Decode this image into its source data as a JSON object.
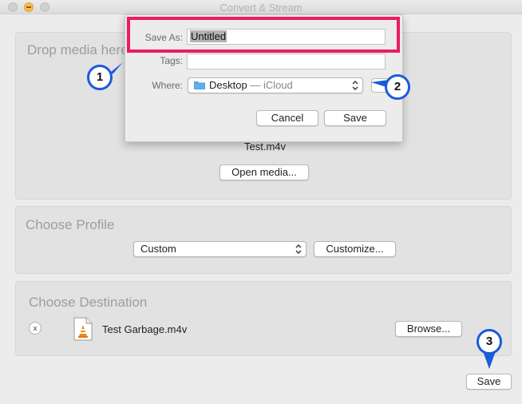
{
  "window": {
    "title": "Convert & Stream"
  },
  "drop_panel": {
    "title": "Drop media here",
    "filename": "Test.m4v",
    "open_button": "Open media..."
  },
  "profile_panel": {
    "title": "Choose Profile",
    "profile_value": "Custom",
    "customize_button": "Customize..."
  },
  "destination_panel": {
    "title": "Choose Destination",
    "remove_label": "x",
    "filename": "Test Garbage.m4v",
    "browse_button": "Browse..."
  },
  "save_button": "Save",
  "save_sheet": {
    "save_as_label": "Save As:",
    "save_as_value": "Untitled",
    "tags_label": "Tags:",
    "tags_value": "",
    "where_label": "Where:",
    "where_location": "Desktop",
    "where_separator": " — ",
    "where_service": "iCloud",
    "cancel_button": "Cancel",
    "save_button": "Save"
  },
  "annotations": {
    "callouts": [
      "1",
      "2",
      "3"
    ],
    "callout_color": "#1c5bd9",
    "highlight_color": "#ea1c62"
  },
  "icons": {
    "folder": "folder-icon",
    "file": "vlc-file-icon",
    "chevron": "updown-chevron-icon"
  }
}
